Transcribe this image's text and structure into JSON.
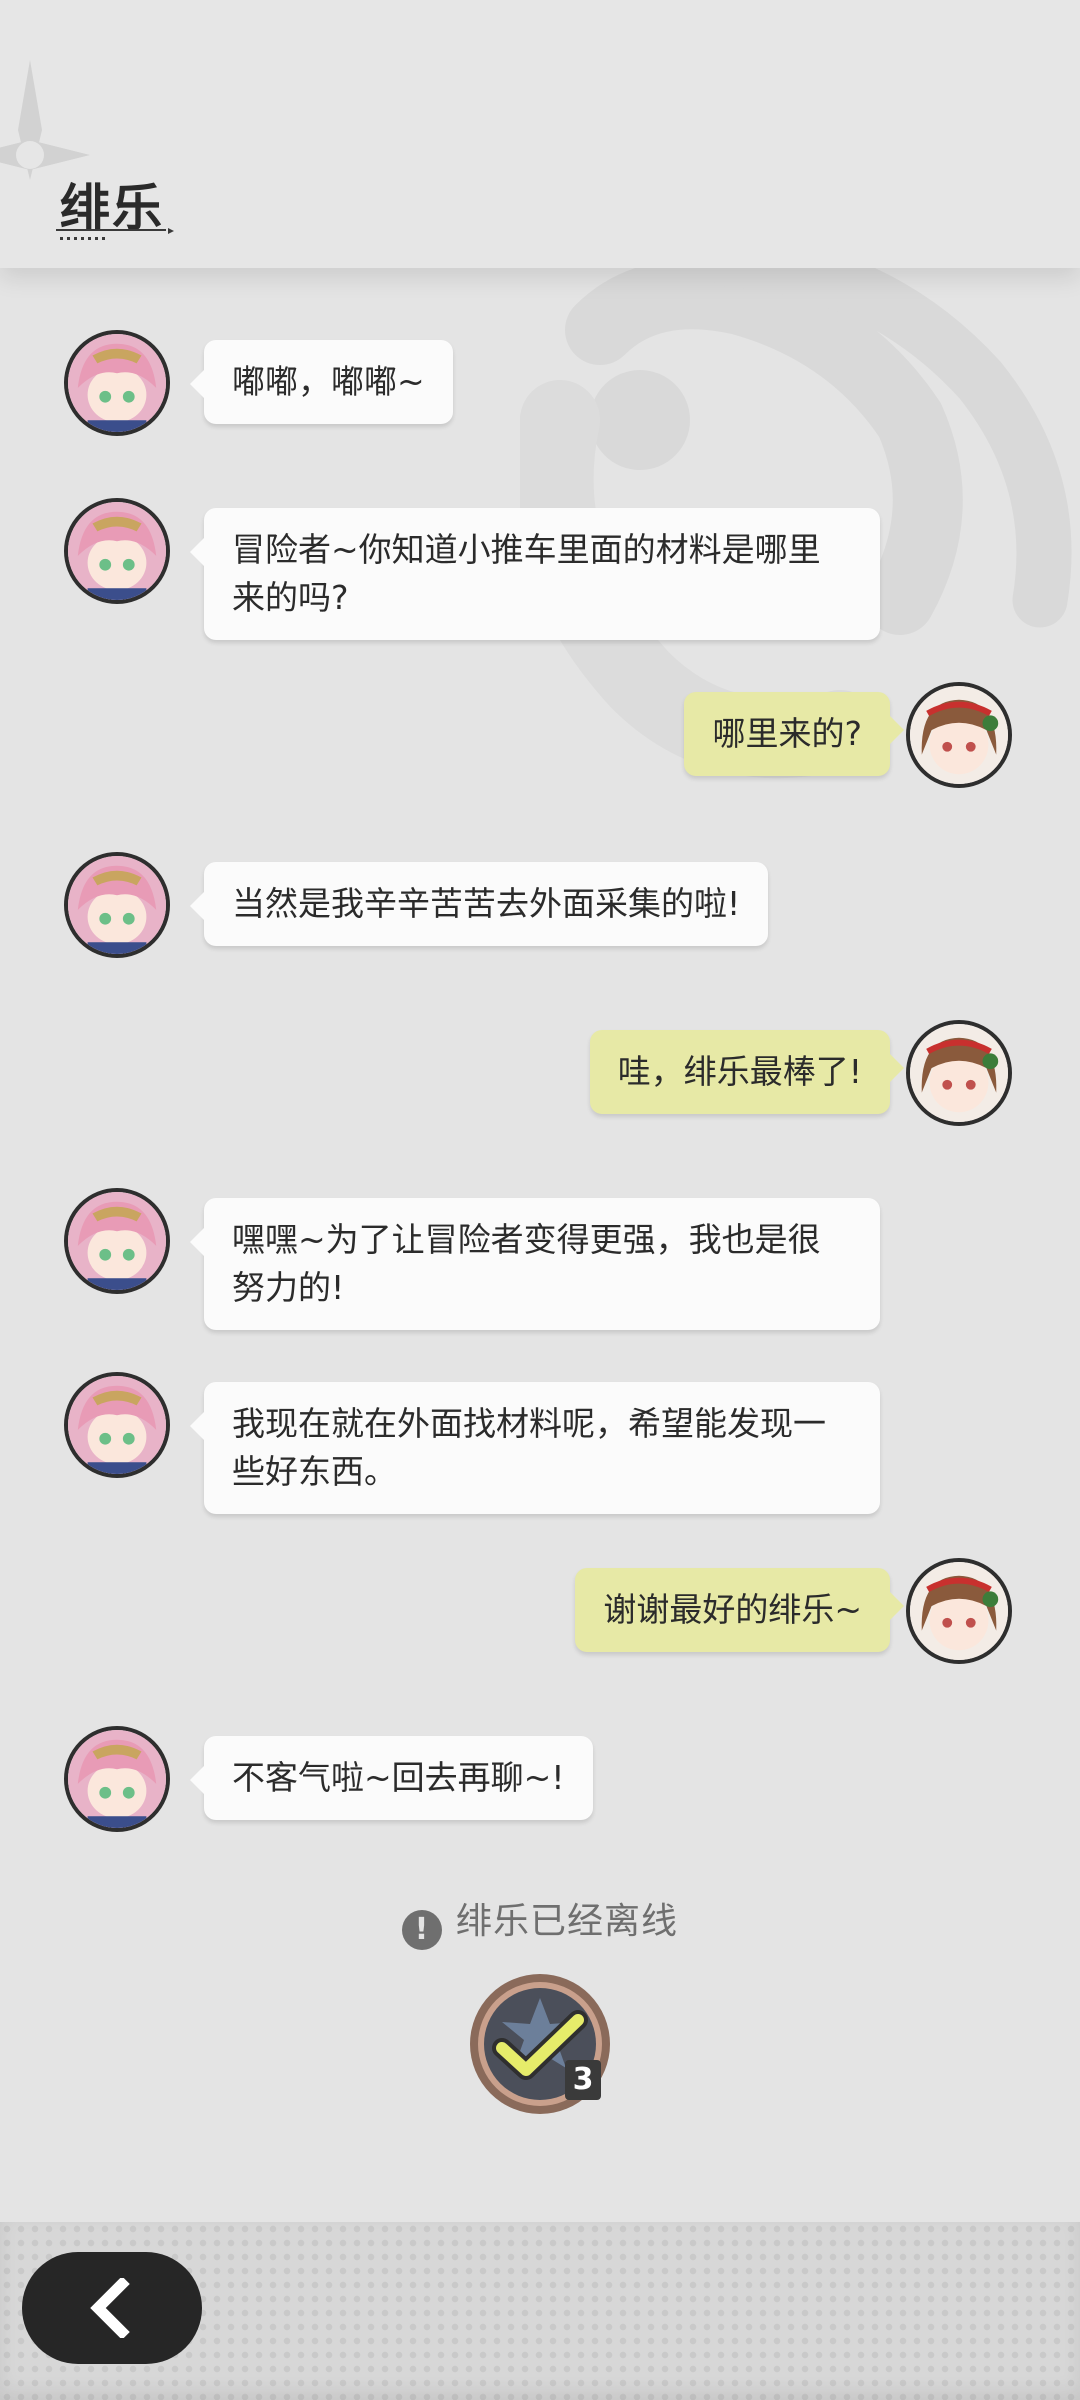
{
  "header": {
    "contact_name": "绯乐"
  },
  "messages": [
    {
      "sender": "npc",
      "text": "嘟嘟，嘟嘟~"
    },
    {
      "sender": "npc",
      "text": "冒险者~你知道小推车里面的材料是哪里来的吗?"
    },
    {
      "sender": "player",
      "text": "哪里来的?"
    },
    {
      "sender": "npc",
      "text": "当然是我辛辛苦苦去外面采集的啦!"
    },
    {
      "sender": "player",
      "text": "哇，绯乐最棒了!"
    },
    {
      "sender": "npc",
      "text": "嘿嘿~为了让冒险者变得更强，我也是很努力的!"
    },
    {
      "sender": "npc",
      "text": "我现在就在外面找材料呢，希望能发现一些好东西。"
    },
    {
      "sender": "player",
      "text": "谢谢最好的绯乐~"
    },
    {
      "sender": "npc",
      "text": "不客气啦~回去再聊~!"
    }
  ],
  "status": {
    "offline_text": "绯乐已经离线",
    "icon": "exclamation-icon"
  },
  "reward": {
    "icon": "checkmark-icon",
    "count": "3"
  },
  "footer": {
    "back_icon": "chevron-left-icon"
  },
  "colors": {
    "background": "#e4e4e4",
    "npc_bubble": "#fbfbfb",
    "player_bubble": "#e7e9a6",
    "back_button": "#262626"
  }
}
